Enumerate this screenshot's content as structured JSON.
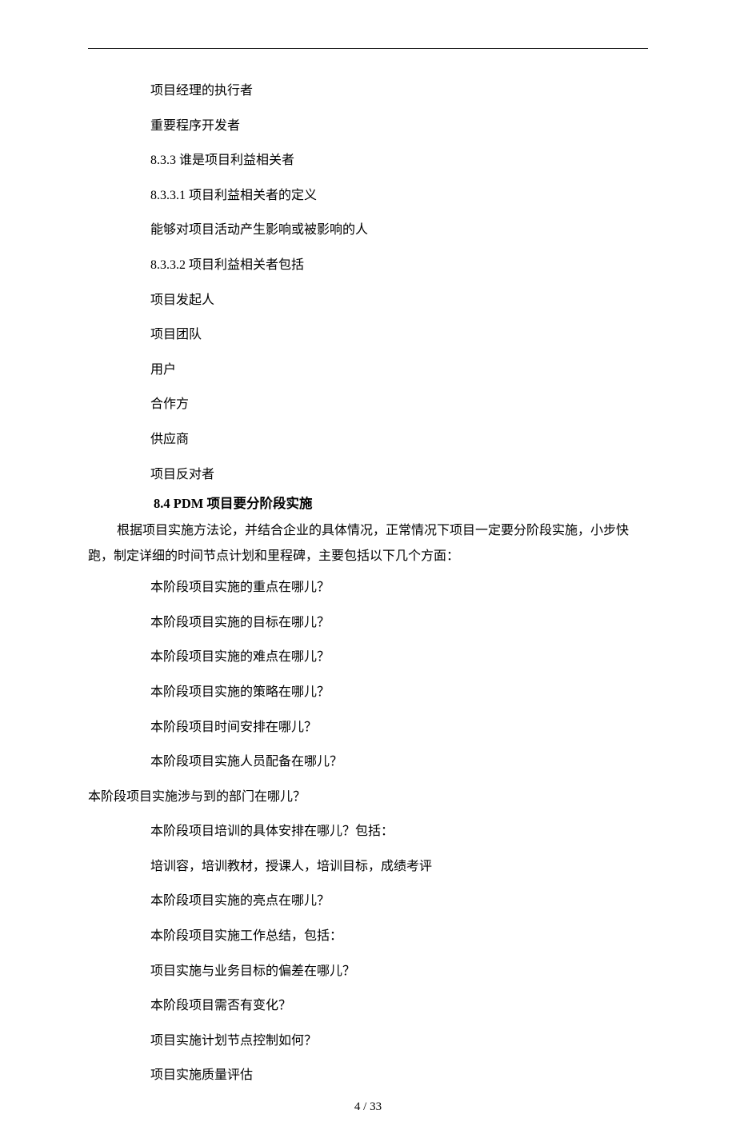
{
  "content": {
    "l1": "项目经理的执行者",
    "l2": "重要程序开发者",
    "l3": "8.3.3 谁是项目利益相关者",
    "l4": "8.3.3.1 项目利益相关者的定义",
    "l5": "能够对项目活动产生影响或被影响的人",
    "l6": "8.3.3.2 项目利益相关者包括",
    "l7": "项目发起人",
    "l8": "项目团队",
    "l9": "用户",
    "l10": "合作方",
    "l11": "供应商",
    "l12": "项目反对者",
    "heading84": "8.4 PDM 项目要分阶段实施",
    "para1": "根据项目实施方法论，并结合企业的具体情况，正常情况下项目一定要分阶段实施，小步快跑，制定详细的时间节点计划和里程碑，主要包括以下几个方面：",
    "q1": "本阶段项目实施的重点在哪儿？",
    "q2": "本阶段项目实施的目标在哪儿？",
    "q3": "本阶段项目实施的难点在哪儿？",
    "q4": "本阶段项目实施的策略在哪儿？",
    "q5": "本阶段项目时间安排在哪儿？",
    "q6": "本阶段项目实施人员配备在哪儿？",
    "q7": "本阶段项目实施涉与到的部门在哪儿？",
    "q8": "本阶段项目培训的具体安排在哪儿？包括：",
    "q9": "培训容，培训教材，授课人，培训目标，成绩考评",
    "q10": "本阶段项目实施的亮点在哪儿？",
    "q11": "本阶段项目实施工作总结，包括：",
    "q12": "项目实施与业务目标的偏差在哪儿？",
    "q13": "本阶段项目需否有变化？",
    "q14": "项目实施计划节点控制如何？",
    "q15": "项目实施质量评估"
  },
  "footer": {
    "page_current": "4",
    "page_sep": " / ",
    "page_total": "33"
  }
}
